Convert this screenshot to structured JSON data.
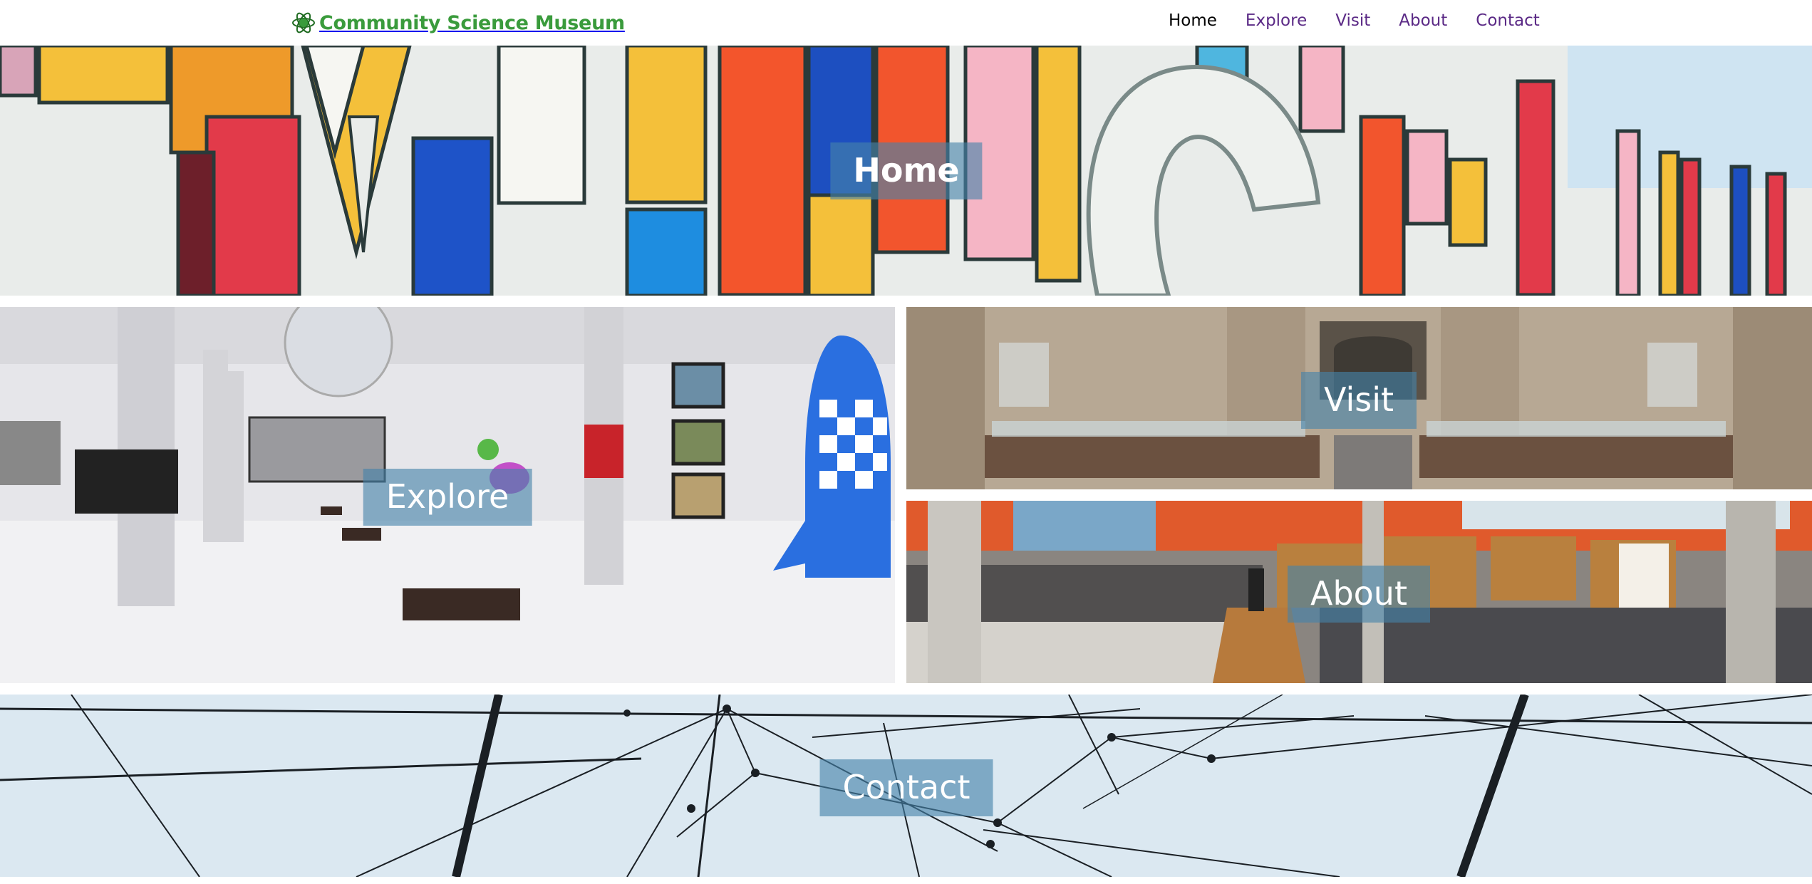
{
  "header": {
    "brand_name": "Community Science Museum",
    "brand_icon": "atom-logo-icon",
    "brand_color": "#3a9b3c"
  },
  "nav": {
    "items": [
      {
        "label": "Home",
        "active": true
      },
      {
        "label": "Explore",
        "active": false
      },
      {
        "label": "Visit",
        "active": false
      },
      {
        "label": "About",
        "active": false
      },
      {
        "label": "Contact",
        "active": false
      }
    ],
    "link_color": "#5b2a86",
    "active_color": "#000000"
  },
  "tiles": {
    "home": {
      "label": "Home",
      "image": "colorful-museum-facade"
    },
    "explore": {
      "label": "Explore",
      "image": "gallery-hall-with-rocket"
    },
    "visit": {
      "label": "Visit",
      "image": "stone-exhibition-hall"
    },
    "about": {
      "label": "About",
      "image": "library-interior-stairs"
    },
    "contact": {
      "label": "Contact",
      "image": "network-cables-sky"
    }
  },
  "label_overlay_color": "rgba(70,130,170,0.62)"
}
